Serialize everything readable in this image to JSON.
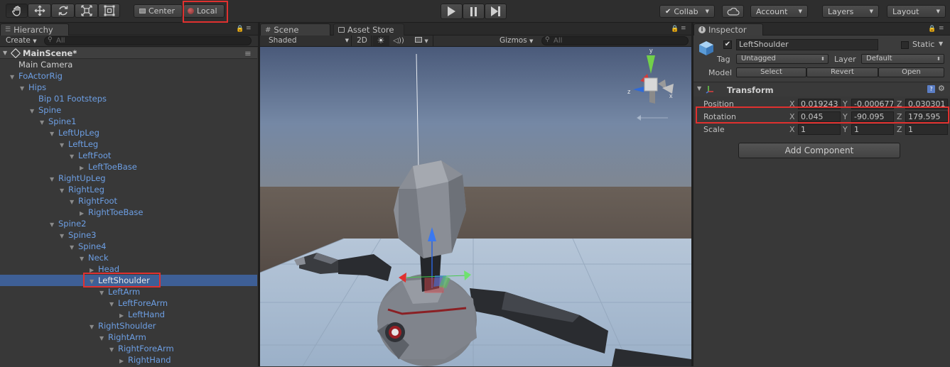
{
  "toolbar": {
    "tools": [
      "hand-tool",
      "move-tool",
      "rotate-tool",
      "scale-tool",
      "rect-tool"
    ],
    "pivot_label": "Center",
    "space_label": "Local",
    "collab_label": "Collab",
    "account_label": "Account",
    "layers_label": "Layers",
    "layout_label": "Layout"
  },
  "hierarchy": {
    "tab_label": "Hierarchy",
    "create_label": "Create",
    "search_placeholder": "All",
    "scene_name": "MainScene*",
    "items": [
      {
        "label": "Main Camera",
        "depth": 0,
        "expanded": null,
        "selected": false,
        "white": true
      },
      {
        "label": "FoActorRig",
        "depth": 0,
        "expanded": true,
        "selected": false
      },
      {
        "label": "Hips",
        "depth": 1,
        "expanded": true,
        "selected": false
      },
      {
        "label": "Bip 01 Footsteps",
        "depth": 2,
        "expanded": null,
        "selected": false
      },
      {
        "label": "Spine",
        "depth": 2,
        "expanded": true,
        "selected": false
      },
      {
        "label": "Spine1",
        "depth": 3,
        "expanded": true,
        "selected": false
      },
      {
        "label": "LeftUpLeg",
        "depth": 4,
        "expanded": true,
        "selected": false
      },
      {
        "label": "LeftLeg",
        "depth": 5,
        "expanded": true,
        "selected": false
      },
      {
        "label": "LeftFoot",
        "depth": 6,
        "expanded": true,
        "selected": false
      },
      {
        "label": "LeftToeBase",
        "depth": 7,
        "expanded": false,
        "selected": false
      },
      {
        "label": "RightUpLeg",
        "depth": 4,
        "expanded": true,
        "selected": false
      },
      {
        "label": "RightLeg",
        "depth": 5,
        "expanded": true,
        "selected": false
      },
      {
        "label": "RightFoot",
        "depth": 6,
        "expanded": true,
        "selected": false
      },
      {
        "label": "RightToeBase",
        "depth": 7,
        "expanded": false,
        "selected": false
      },
      {
        "label": "Spine2",
        "depth": 4,
        "expanded": true,
        "selected": false
      },
      {
        "label": "Spine3",
        "depth": 5,
        "expanded": true,
        "selected": false
      },
      {
        "label": "Spine4",
        "depth": 6,
        "expanded": true,
        "selected": false
      },
      {
        "label": "Neck",
        "depth": 7,
        "expanded": true,
        "selected": false
      },
      {
        "label": "Head",
        "depth": 8,
        "expanded": false,
        "selected": false
      },
      {
        "label": "LeftShoulder",
        "depth": 8,
        "expanded": true,
        "selected": true
      },
      {
        "label": "LeftArm",
        "depth": 9,
        "expanded": true,
        "selected": false
      },
      {
        "label": "LeftForeArm",
        "depth": 10,
        "expanded": true,
        "selected": false
      },
      {
        "label": "LeftHand",
        "depth": 11,
        "expanded": false,
        "selected": false
      },
      {
        "label": "RightShoulder",
        "depth": 8,
        "expanded": true,
        "selected": false
      },
      {
        "label": "RightArm",
        "depth": 9,
        "expanded": true,
        "selected": false
      },
      {
        "label": "RightForeArm",
        "depth": 10,
        "expanded": true,
        "selected": false
      },
      {
        "label": "RightHand",
        "depth": 11,
        "expanded": false,
        "selected": false
      }
    ]
  },
  "scene": {
    "tab_label": "Scene",
    "asset_store_label": "Asset Store",
    "shading_mode": "Shaded",
    "mode_2d": "2D",
    "gizmos_label": "Gizmos",
    "search_placeholder": "All",
    "gizmo_axes": {
      "y": "y",
      "x": "x",
      "z": "z"
    }
  },
  "inspector": {
    "tab_label": "Inspector",
    "object_name": "LeftShoulder",
    "active": true,
    "static_label": "Static",
    "tag_label": "Tag",
    "tag_value": "Untagged",
    "layer_label": "Layer",
    "layer_value": "Default",
    "model_label": "Model",
    "model_buttons": [
      "Select",
      "Revert",
      "Open"
    ],
    "component_title": "Transform",
    "rows": [
      {
        "label": "Position",
        "x": "0.019243",
        "y": "-0.000677",
        "z": "0.030301"
      },
      {
        "label": "Rotation",
        "x": "0.045",
        "y": "-90.095",
        "z": "179.595"
      },
      {
        "label": "Scale",
        "x": "1",
        "y": "1",
        "z": "1"
      }
    ],
    "axis_labels": {
      "x": "X",
      "y": "Y",
      "z": "Z"
    },
    "add_component_label": "Add Component"
  },
  "colors": {
    "selection": "#3e5f96",
    "highlight": "#e0312f",
    "prefab_text": "#6d9fe4"
  }
}
